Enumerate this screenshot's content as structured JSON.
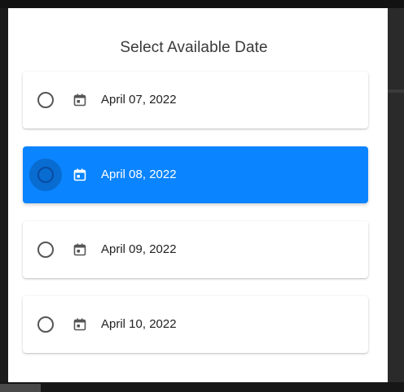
{
  "dialog": {
    "title": "Select Available Date",
    "options": [
      {
        "label": "April 07, 2022",
        "selected": false
      },
      {
        "label": "April 08, 2022",
        "selected": true
      },
      {
        "label": "April 09, 2022",
        "selected": false
      },
      {
        "label": "April 10, 2022",
        "selected": false
      }
    ]
  },
  "icons": {
    "radio": "radio-button-icon",
    "calendar": "calendar-icon"
  },
  "colors": {
    "selected_bg": "#0a84ff",
    "dialog_bg": "#ffffff",
    "backdrop": "#1b1b1b"
  }
}
